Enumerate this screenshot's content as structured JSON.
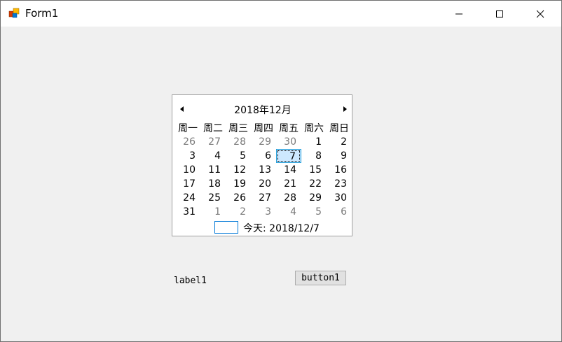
{
  "window": {
    "title": "Form1"
  },
  "calendar": {
    "month_title": "2018年12月",
    "weekdays": [
      "周一",
      "周二",
      "周三",
      "周四",
      "周五",
      "周六",
      "周日"
    ],
    "weeks": [
      [
        "26",
        "27",
        "28",
        "29",
        "30",
        "1",
        "2"
      ],
      [
        "3",
        "4",
        "5",
        "6",
        "7",
        "8",
        "9"
      ],
      [
        "10",
        "11",
        "12",
        "13",
        "14",
        "15",
        "16"
      ],
      [
        "17",
        "18",
        "19",
        "20",
        "21",
        "22",
        "23"
      ],
      [
        "24",
        "25",
        "26",
        "27",
        "28",
        "29",
        "30"
      ],
      [
        "31",
        "1",
        "2",
        "3",
        "4",
        "5",
        "6"
      ]
    ],
    "selected_day": "7",
    "today_label": "今天: 2018/12/7"
  },
  "label1": {
    "text": "label1"
  },
  "button1": {
    "label": "button1"
  },
  "colors": {
    "selection_fill": "#cde8ff",
    "selection_border": "#26a0da",
    "other_month_text": "#7a7a7a",
    "today_box": "#0078d7"
  }
}
